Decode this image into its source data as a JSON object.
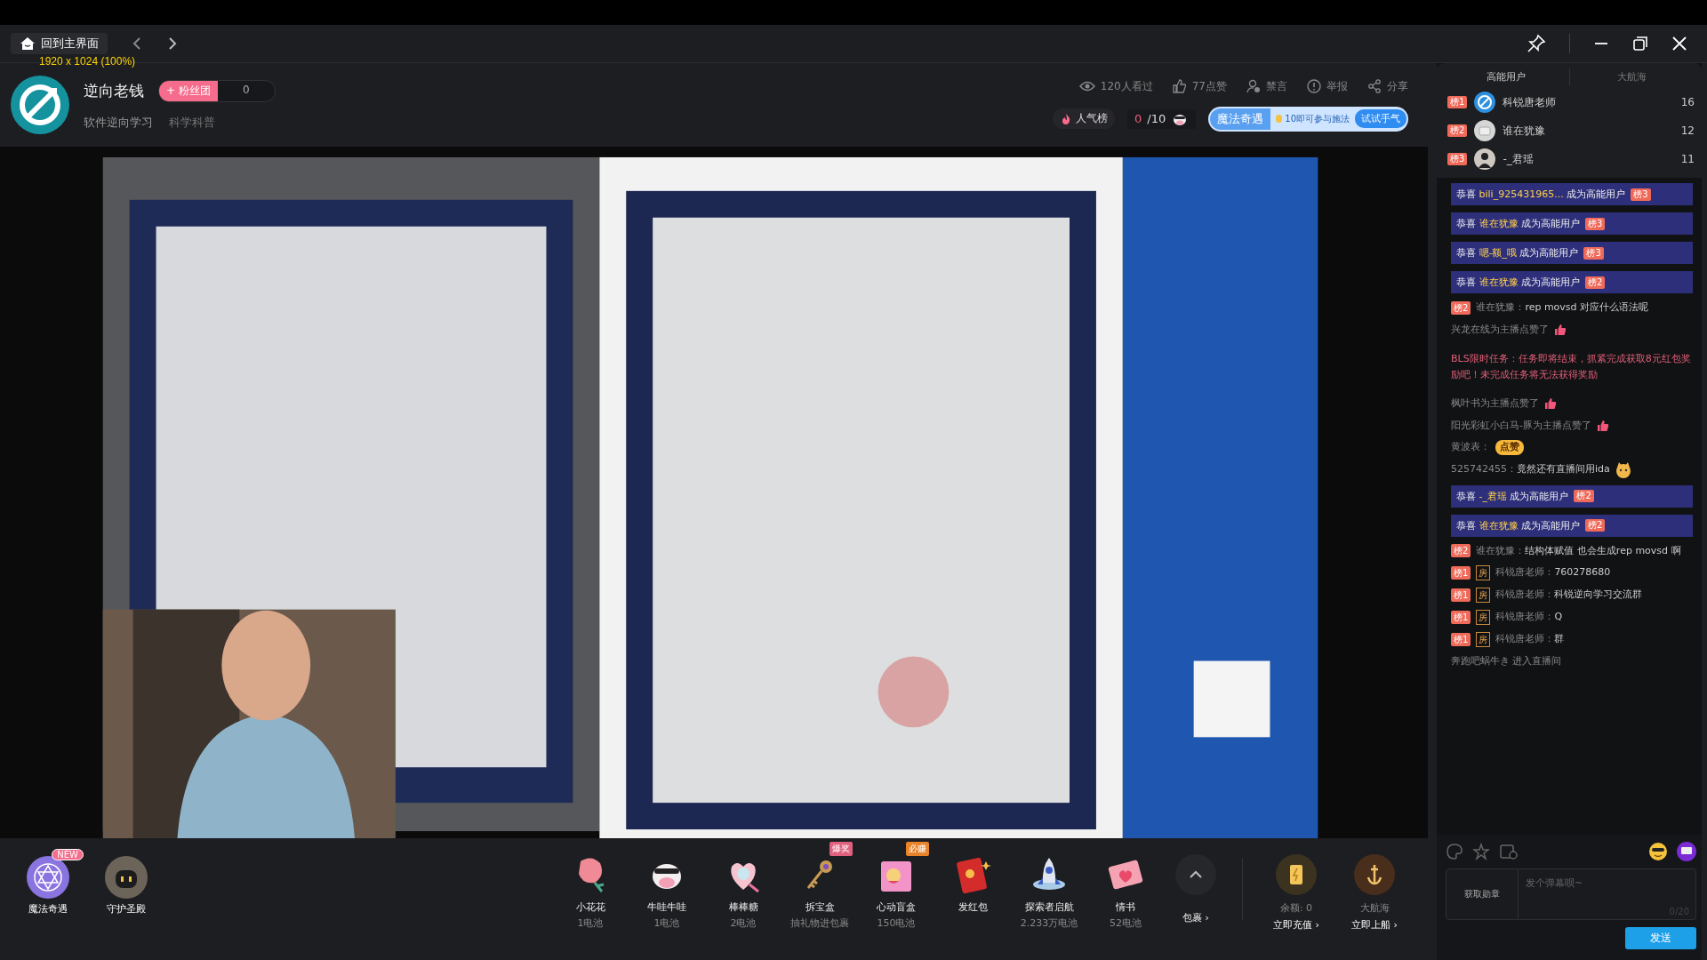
{
  "capture_size_label": "1920 x 1024 (100%)",
  "titlebar": {
    "home_button": "回到主界面"
  },
  "streamer": {
    "name": "逆向老钱",
    "fan_club_button": "+ 粉丝团",
    "fan_count": "0",
    "tags": [
      "软件逆向学习",
      "科学科普"
    ]
  },
  "stats": [
    {
      "kind": "views",
      "label": "120人看过"
    },
    {
      "kind": "likes",
      "label": "77点赞"
    },
    {
      "kind": "mute",
      "label": "禁言"
    },
    {
      "kind": "report",
      "label": "举报"
    },
    {
      "kind": "share",
      "label": "分享"
    }
  ],
  "popularity_button": "人气榜",
  "task_counter": {
    "done": "0",
    "total": "/10"
  },
  "magic_banner": {
    "title": "魔法奇遇",
    "text": "10即可参与施法",
    "button": "试试手气"
  },
  "activities": [
    {
      "label": "魔法奇遇",
      "badge": "NEW"
    },
    {
      "label": "守护圣殿"
    }
  ],
  "gifts": [
    {
      "kind": "flower",
      "name": "小花花",
      "price": "1电池"
    },
    {
      "kind": "cow",
      "name": "牛哇牛哇",
      "price": "1电池"
    },
    {
      "kind": "candy",
      "name": "棒棒糖",
      "price": "2电池"
    },
    {
      "kind": "key",
      "name": "拆宝盒",
      "price": "抽礼物进包裹",
      "tag": {
        "label": "爆奖",
        "color": "#e0607e"
      }
    },
    {
      "kind": "box",
      "name": "心动盲盒",
      "price": "150电池",
      "tag": {
        "label": "必赚",
        "color": "#e8832a"
      }
    },
    {
      "kind": "envelope",
      "name": "发红包"
    },
    {
      "kind": "rocket",
      "name": "探索者启航",
      "price": "2.233万电池"
    },
    {
      "kind": "letter",
      "name": "情书",
      "price": "52电池"
    }
  ],
  "package_button": "包裹 ›",
  "balance": {
    "label": "余额: 0",
    "button": "立即充值 ›"
  },
  "guard": {
    "label": "大航海",
    "button": "立即上船 ›"
  },
  "ranking_tabs": [
    {
      "label": "高能用户",
      "selected": true
    },
    {
      "label": "大航海",
      "selected": false
    }
  ],
  "ranking": [
    {
      "kind": "logo",
      "rank": "榜1",
      "name": "科锐唐老师",
      "score": "16"
    },
    {
      "kind": "robot",
      "rank": "榜2",
      "name": "谁在犹豫",
      "score": "12"
    },
    {
      "kind": "person",
      "rank": "榜3",
      "name": "-_君瑶",
      "score": "11"
    }
  ],
  "chat": [
    {
      "kind": "congrats",
      "prefix": "恭喜",
      "name": "bili_925431965...",
      "suffix": "成为高能用户",
      "rank": "榜3"
    },
    {
      "kind": "congrats",
      "prefix": "恭喜",
      "name": "谁在犹豫",
      "suffix": "成为高能用户",
      "rank": "榜3"
    },
    {
      "kind": "congrats",
      "prefix": "恭喜",
      "name": "嗯-额_哦",
      "suffix": "成为高能用户",
      "rank": "榜3"
    },
    {
      "kind": "congrats",
      "prefix": "恭喜",
      "name": "谁在犹豫",
      "suffix": "成为高能用户",
      "rank": "榜2"
    },
    {
      "kind": "comment",
      "rank": "榜2",
      "user": "谁在犹豫：",
      "text": "rep movsd 对应什么语法呢"
    },
    {
      "kind": "like",
      "text": "兴龙在线为主播点赞了"
    },
    {
      "kind": "system",
      "text": "BLS限时任务：任务即将结束，抓紧完成获取8元红包奖励吧！未完成任务将无法获得奖励"
    },
    {
      "kind": "like",
      "text": "枫叶书为主播点赞了"
    },
    {
      "kind": "like",
      "text": "阳光彩虹小白马-豚为主播点赞了"
    },
    {
      "kind": "sticker",
      "user": "黄波表：",
      "text": "点赞"
    },
    {
      "kind": "comment",
      "user": "525742455：",
      "text": "竟然还有直播间用ida",
      "emoji": true
    },
    {
      "kind": "congrats",
      "prefix": "恭喜",
      "name": "-_君瑶",
      "suffix": "成为高能用户",
      "rank": "榜2"
    },
    {
      "kind": "congrats",
      "prefix": "恭喜",
      "name": "谁在犹豫",
      "suffix": "成为高能用户",
      "rank": "榜2"
    },
    {
      "kind": "comment",
      "rank": "榜2",
      "user": "谁在犹豫：",
      "text": "结构体赋值 也会生成rep movsd 啊"
    },
    {
      "kind": "comment",
      "rank": "榜1",
      "room": "房",
      "user": "科锐唐老师：",
      "text": "760278680"
    },
    {
      "kind": "comment",
      "rank": "榜1",
      "room": "房",
      "user": "科锐唐老师：",
      "text": "科锐逆向学习交流群"
    },
    {
      "kind": "comment",
      "rank": "榜1",
      "room": "房",
      "user": "科锐唐老师：",
      "text": "Q"
    },
    {
      "kind": "comment",
      "rank": "榜1",
      "room": "房",
      "user": "科锐唐老师：",
      "text": "群"
    },
    {
      "kind": "enter",
      "text": "奔跑吧蜗牛き 进入直播间"
    }
  ],
  "composer": {
    "medal_button": "获取勋章",
    "placeholder": "发个弹幕呗~",
    "counter": "0/20",
    "send_button": "发送"
  }
}
